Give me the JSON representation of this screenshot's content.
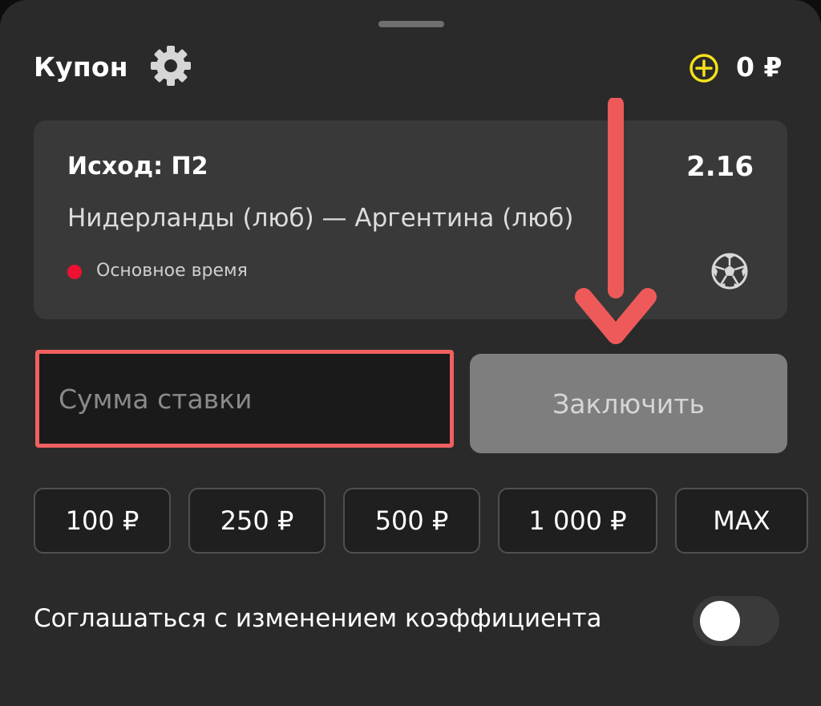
{
  "coupon": {
    "title": "Купон",
    "balance": "0 ₽"
  },
  "bet": {
    "outcome": "Исход: П2",
    "odds": "2.16",
    "event": "Нидерланды (люб) — Аргентина (люб)",
    "period": "Основное время",
    "sport_icon": "soccer-ball-icon"
  },
  "stake": {
    "value": "",
    "placeholder": "Сумма ставки"
  },
  "submit_label": "Заключить",
  "quick_amounts": [
    "100 ₽",
    "250 ₽",
    "500 ₽",
    "1 000 ₽",
    "MAX"
  ],
  "accept_odds_change": {
    "label": "Соглашаться с изменением коэффициента",
    "enabled": false
  },
  "colors": {
    "background": "#2a2a2a",
    "card": "#393939",
    "highlight": "#f06060",
    "live_dot": "#ee1133",
    "topup_icon": "#f5e11a"
  }
}
